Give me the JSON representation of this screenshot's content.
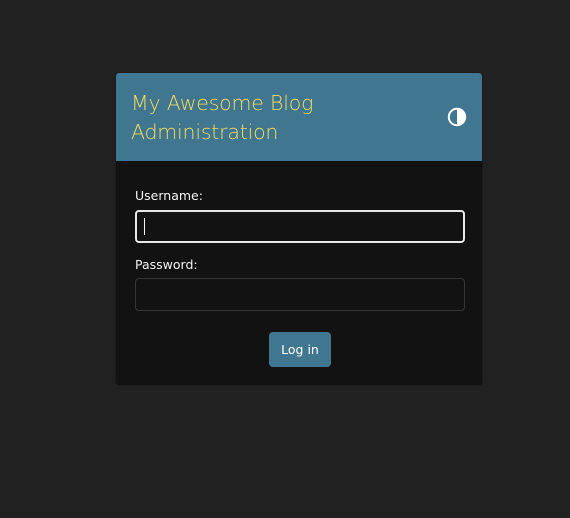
{
  "header": {
    "title": "My Awesome Blog Administration",
    "theme_toggle_icon": "half-circle-contrast-icon"
  },
  "form": {
    "username_label": "Username:",
    "username_value": "",
    "password_label": "Password:",
    "password_value": "",
    "submit_label": "Log in"
  },
  "colors": {
    "page_background": "#212121",
    "card_background": "#121212",
    "header_background": "#417690",
    "title_color": "#f5dd5d",
    "button_background": "#417690"
  }
}
